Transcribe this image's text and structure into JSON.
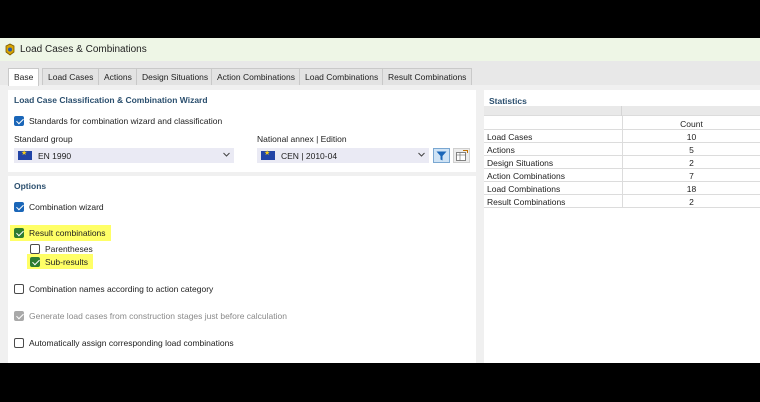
{
  "window": {
    "title": "Load Cases & Combinations"
  },
  "tabs": [
    {
      "label": "Base"
    },
    {
      "label": "Load Cases"
    },
    {
      "label": "Actions"
    },
    {
      "label": "Design Situations"
    },
    {
      "label": "Action Combinations"
    },
    {
      "label": "Load Combinations"
    },
    {
      "label": "Result Combinations"
    }
  ],
  "wizard": {
    "heading": "Load Case Classification & Combination Wizard",
    "standards_checkbox": "Standards for combination wizard and classification",
    "standard_group_label": "Standard group",
    "standard_group_value": "EN 1990",
    "national_annex_label": "National annex | Edition",
    "national_annex_value": "CEN | 2010-04"
  },
  "options": {
    "heading": "Options",
    "combination_wizard": "Combination wizard",
    "result_combinations": "Result combinations",
    "parentheses": "Parentheses",
    "sub_results": "Sub-results",
    "combination_names": "Combination names according to action category",
    "generate_load_cases": "Generate load cases from construction stages just before calculation",
    "auto_assign": "Automatically assign corresponding load combinations"
  },
  "statistics": {
    "heading": "Statistics",
    "count_header": "Count",
    "rows": [
      {
        "label": "Load Cases",
        "count": "10"
      },
      {
        "label": "Actions",
        "count": "5"
      },
      {
        "label": "Design Situations",
        "count": "2"
      },
      {
        "label": "Action Combinations",
        "count": "7"
      },
      {
        "label": "Load Combinations",
        "count": "18"
      },
      {
        "label": "Result Combinations",
        "count": "2"
      }
    ]
  },
  "colors": {
    "accent": "#1a66b8",
    "heading": "#2b4f6e",
    "highlight": "#ffff66",
    "checkbox_green": "#2e7d32"
  }
}
